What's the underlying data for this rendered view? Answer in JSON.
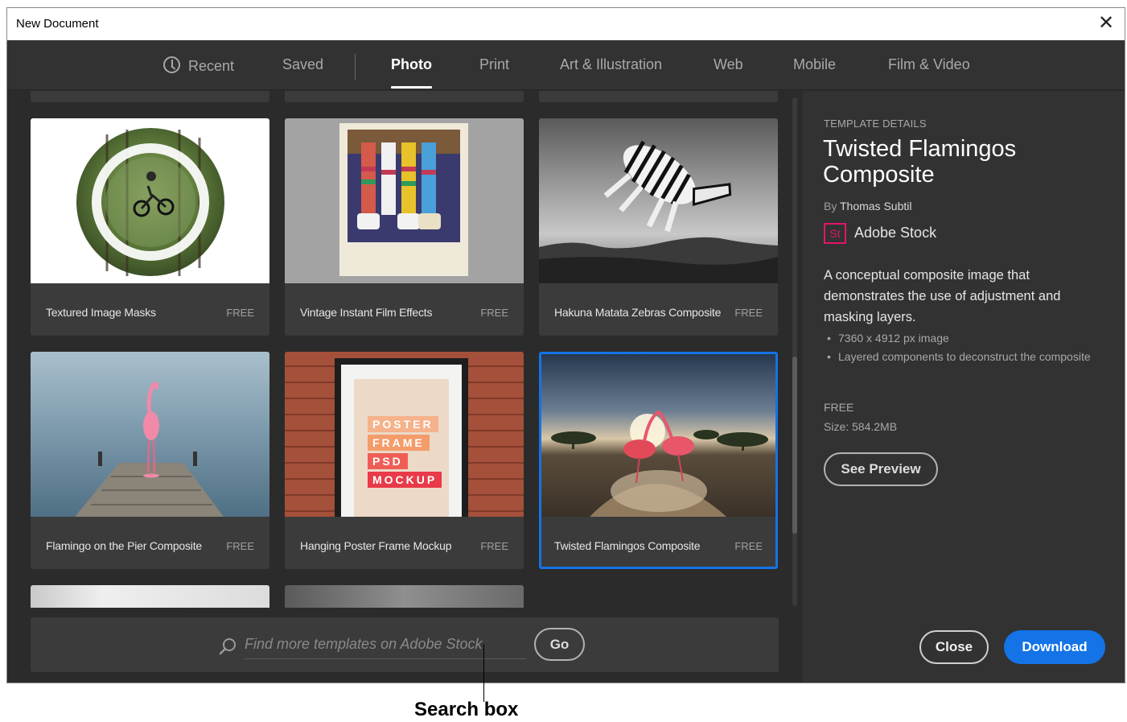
{
  "window": {
    "title": "New Document",
    "close_icon": "close-icon"
  },
  "tabs": [
    {
      "label": "Recent",
      "icon": "clock-icon"
    },
    {
      "label": "Saved"
    },
    {
      "label": "Photo",
      "active": true
    },
    {
      "label": "Print"
    },
    {
      "label": "Art & Illustration"
    },
    {
      "label": "Web"
    },
    {
      "label": "Mobile"
    },
    {
      "label": "Film & Video"
    }
  ],
  "templates": [
    {
      "name": "Textured Image Masks",
      "price": "FREE"
    },
    {
      "name": "Vintage Instant Film Effects",
      "price": "FREE"
    },
    {
      "name": "Hakuna Matata Zebras Composite",
      "price": "FREE"
    },
    {
      "name": "Flamingo on the Pier Composite",
      "price": "FREE"
    },
    {
      "name": "Hanging Poster Frame Mockup",
      "price": "FREE",
      "poster_lines": [
        "POSTER",
        "FRAME",
        "PSD",
        "MOCKUP"
      ]
    },
    {
      "name": "Twisted Flamingos Composite",
      "price": "FREE",
      "selected": true
    }
  ],
  "search": {
    "placeholder": "Find more templates on Adobe Stock",
    "go_label": "Go"
  },
  "details": {
    "section_label": "TEMPLATE DETAILS",
    "title": "Twisted Flamingos Composite",
    "by_prefix": "By",
    "author": "Thomas Subtil",
    "source_badge": "St",
    "source_name": "Adobe Stock",
    "description": "A conceptual composite image that demonstrates the use of adjustment and masking layers.",
    "bullets": [
      "7360 x 4912 px image",
      "Layered components to deconstruct the composite"
    ],
    "price": "FREE",
    "size": "Size: 584.2MB",
    "preview_label": "See Preview",
    "accent_color": "#1473e6",
    "stock_color": "#e2156b"
  },
  "actions": {
    "close_label": "Close",
    "download_label": "Download"
  },
  "annotation": {
    "label": "Search box"
  }
}
